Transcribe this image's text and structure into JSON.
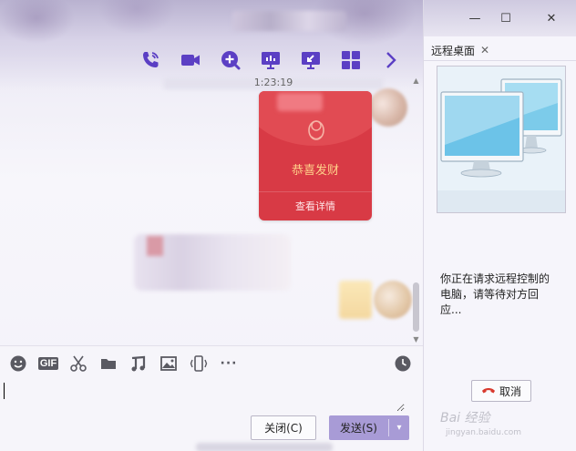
{
  "chat": {
    "toolbar": {
      "items": [
        "voice-call",
        "video-call",
        "qq-app",
        "screen-share",
        "remote-desktop",
        "more-apps",
        "expand"
      ]
    },
    "timestamp": "1:23:19",
    "red_packet": {
      "title": "恭喜发财",
      "footer": "查看详情"
    },
    "input_toolbar": {
      "gif_label": "GIF",
      "more_label": "···"
    },
    "buttons": {
      "close": "关闭(C)",
      "send": "发送(S)",
      "send_dropdown": "▾"
    }
  },
  "remote": {
    "window_controls": {
      "minimize": "—",
      "maximize": "☐",
      "close": "✕"
    },
    "tab_label": "远程桌面",
    "tab_close": "✕",
    "request_text": "你正在请求远程控制的电脑，请等待对方回应...",
    "cancel_label": "取消",
    "watermark": "Bai 经验",
    "watermark_sub": "jingyan.baidu.com"
  },
  "colors": {
    "accent_purple": "#5b3fc4",
    "red_packet": "#d83a45",
    "red_packet_title": "#ffd28a",
    "send_button": "#a89bd6"
  }
}
